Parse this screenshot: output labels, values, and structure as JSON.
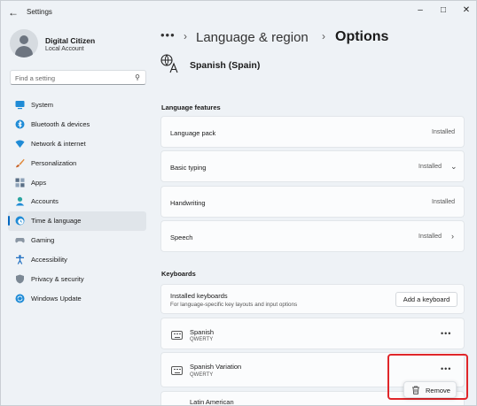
{
  "window": {
    "title": "Settings",
    "back_icon": "back-arrow-icon",
    "controls": {
      "minimize": "–",
      "maximize": "□",
      "close": "✕"
    }
  },
  "profile": {
    "name": "Digital Citizen",
    "account_type": "Local Account"
  },
  "search": {
    "placeholder": "Find a setting"
  },
  "nav": {
    "items": [
      {
        "label": "System",
        "icon": "system-icon",
        "color": "#1f8bd6"
      },
      {
        "label": "Bluetooth & devices",
        "icon": "bluetooth-icon",
        "color": "#1f8bd6"
      },
      {
        "label": "Network & internet",
        "icon": "network-icon",
        "color": "#1f8bd6"
      },
      {
        "label": "Personalization",
        "icon": "brush-icon",
        "color": "#e08a3c"
      },
      {
        "label": "Apps",
        "icon": "apps-icon",
        "color": "#5a6f86"
      },
      {
        "label": "Accounts",
        "icon": "accounts-icon",
        "color": "#2aa5a0"
      },
      {
        "label": "Time & language",
        "icon": "globe-clock-icon",
        "color": "#1f8bd6"
      },
      {
        "label": "Gaming",
        "icon": "gamepad-icon",
        "color": "#8a96a3"
      },
      {
        "label": "Accessibility",
        "icon": "accessibility-icon",
        "color": "#1f6fc1"
      },
      {
        "label": "Privacy & security",
        "icon": "shield-icon",
        "color": "#7c8894"
      },
      {
        "label": "Windows Update",
        "icon": "update-icon",
        "color": "#1f8bd6"
      }
    ],
    "active_index": 6
  },
  "breadcrumb": {
    "more": "•••",
    "parent": "Language & region",
    "current": "Options"
  },
  "language": {
    "name": "Spanish (Spain)",
    "icon": "language-icon"
  },
  "language_features": {
    "heading": "Language features",
    "items": [
      {
        "label": "Language pack",
        "status": "Installed",
        "chevron": ""
      },
      {
        "label": "Basic typing",
        "status": "Installed",
        "chevron": "down"
      },
      {
        "label": "Handwriting",
        "status": "Installed",
        "chevron": ""
      },
      {
        "label": "Speech",
        "status": "Installed",
        "chevron": "right"
      }
    ]
  },
  "keyboards": {
    "heading": "Keyboards",
    "installed_title": "Installed keyboards",
    "installed_desc": "For language-specific key layouts and input options",
    "add_button": "Add a keyboard",
    "list": [
      {
        "name": "Spanish",
        "layout": "QWERTY"
      },
      {
        "name": "Spanish Variation",
        "layout": "QWERTY"
      },
      {
        "name": "Latin American",
        "layout": ""
      }
    ],
    "more_label": "•••"
  },
  "context_menu": {
    "remove_label": "Remove",
    "icon": "trash-icon"
  },
  "colors": {
    "accent": "#0067c0",
    "highlight": "#e0262a"
  }
}
